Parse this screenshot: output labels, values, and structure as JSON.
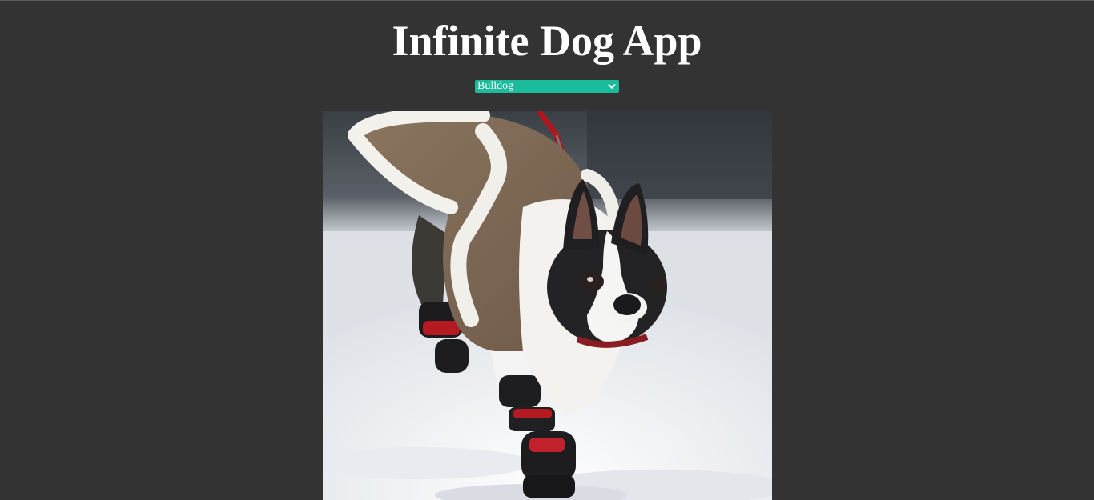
{
  "app": {
    "title": "Infinite Dog App"
  },
  "breed_select": {
    "selected": "Bulldog",
    "accent_color": "#1abc9c"
  },
  "dog_photo": {
    "subject": "dog-photo"
  },
  "colors": {
    "background": "#333333",
    "title_text": "#ffffff"
  }
}
